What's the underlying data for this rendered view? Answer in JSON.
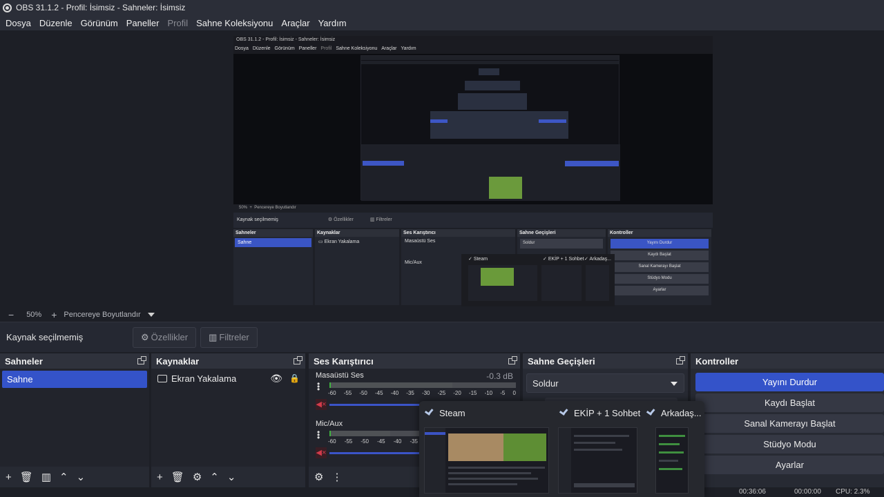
{
  "window": {
    "title": "OBS 31.1.2 - Profil: İsimsiz - Sahneler: İsimsiz"
  },
  "menu": {
    "items": [
      "Dosya",
      "Düzenle",
      "Görünüm",
      "Paneller",
      "Profil",
      "Sahne Koleksiyonu",
      "Araçlar",
      "Yardım"
    ]
  },
  "zoom": {
    "minus": "−",
    "level": "50%",
    "plus": "+",
    "fit": "Pencereye Boyutlandır"
  },
  "properties": {
    "no_source": "Kaynak seçilmemiş",
    "props_button": "Özellikler",
    "filters_button": "Filtreler"
  },
  "scenes": {
    "title": "Sahneler",
    "items": [
      "Sahne"
    ]
  },
  "sources": {
    "title": "Kaynaklar",
    "items": [
      "Ekran Yakalama"
    ]
  },
  "mixer": {
    "title": "Ses Karıştırıcı",
    "channels": [
      {
        "name": "Masaüstü Ses",
        "db": "-0.3 dB",
        "level": 0.01
      },
      {
        "name": "Mic/Aux",
        "db": "",
        "level": 0.01
      }
    ],
    "ticks": [
      "-60",
      "-55",
      "-50",
      "-45",
      "-40",
      "-35",
      "-30",
      "-25",
      "-20",
      "-15",
      "-10",
      "-5",
      "0"
    ]
  },
  "transitions": {
    "title": "Sahne Geçişleri",
    "selected": "Soldur"
  },
  "controls": {
    "title": "Kontroller",
    "buttons": [
      "Yayını Durdur",
      "Kaydı Başlat",
      "Sanal Kamerayı Başlat",
      "Stüdyo Modu",
      "Ayarlar"
    ]
  },
  "popup": {
    "tabs": [
      "Steam",
      "EKİP + 1 Sohbet",
      "Arkadaş..."
    ]
  },
  "status": {
    "stream_time": "00:36:06",
    "rec_time": "00:00:00",
    "cpu": "CPU: 2.3%"
  },
  "colors": {
    "accent": "#3453c9",
    "background": "#1d1f26",
    "panel": "#272a33",
    "mute_red": "#d23b4b"
  },
  "icons": {
    "add": "+",
    "remove": "trash-icon",
    "filters": "filter-icon",
    "up": "chevron-up-icon",
    "down": "chevron-down-icon",
    "settings": "gear-icon",
    "menu": "dots-vertical-icon",
    "visibility": "eye-icon",
    "lock": "lock-icon"
  }
}
